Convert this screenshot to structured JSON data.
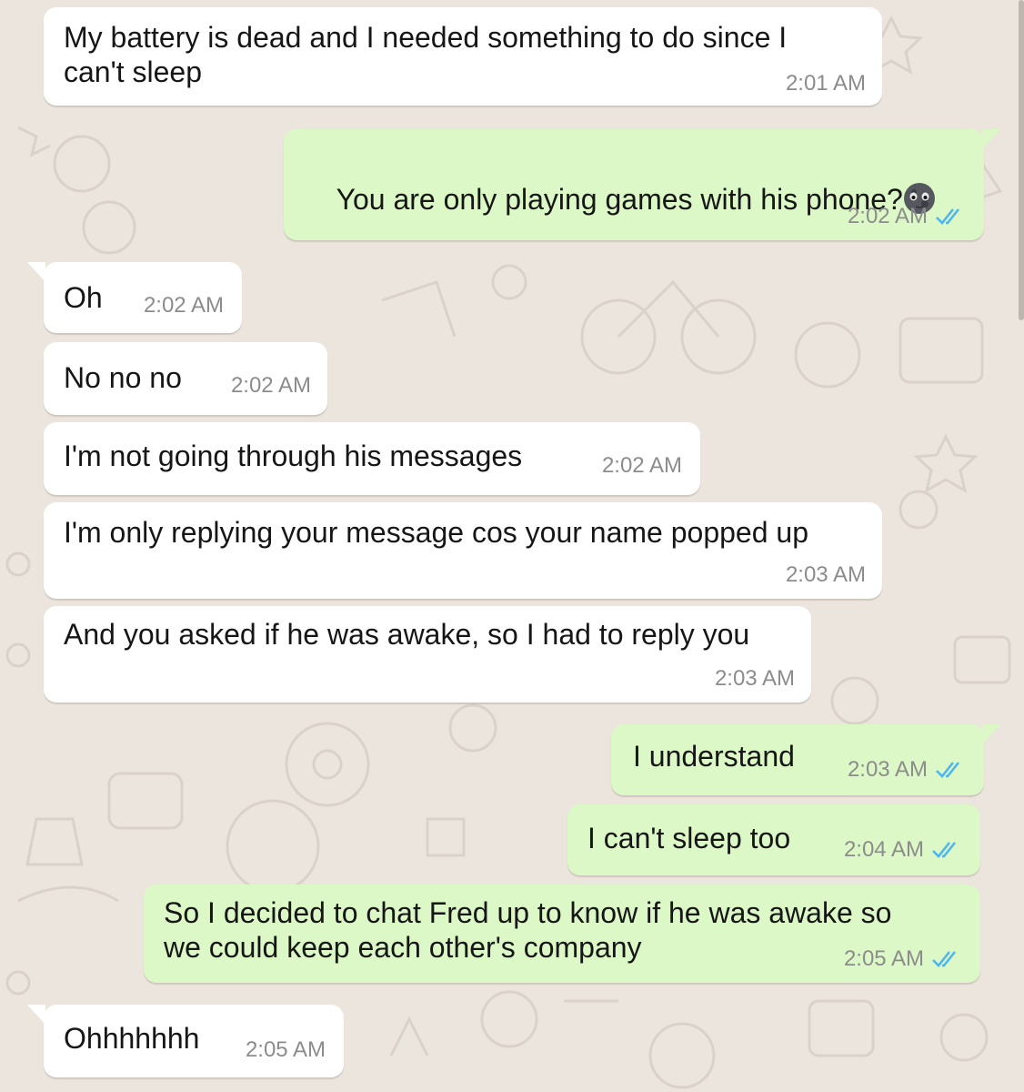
{
  "theme": {
    "incoming_bg": "#ffffff",
    "outgoing_bg": "#dcf8c6",
    "read_tick_color": "#4fb6ec",
    "wallpaper_bg": "#ece5dd"
  },
  "messages": [
    {
      "direction": "in",
      "text": "My battery is dead and I needed something to do since I\ncan't sleep",
      "time": "2:01 AM"
    },
    {
      "direction": "out",
      "text": "You are only playing games with his phone?",
      "emoji": "new-moon-face",
      "time": "2:02 AM",
      "status": "read"
    },
    {
      "direction": "in",
      "text": "Oh",
      "time": "2:02 AM"
    },
    {
      "direction": "in",
      "text": "No no no",
      "time": "2:02 AM"
    },
    {
      "direction": "in",
      "text": "I'm not going through his messages",
      "time": "2:02 AM"
    },
    {
      "direction": "in",
      "text": "I'm only replying your message cos your name popped up",
      "time": "2:03 AM"
    },
    {
      "direction": "in",
      "text": "And you asked if he was awake, so I had to reply you",
      "time": "2:03 AM"
    },
    {
      "direction": "out",
      "text": "I understand",
      "time": "2:03 AM",
      "status": "read"
    },
    {
      "direction": "out",
      "text": "I can't sleep too",
      "time": "2:04 AM",
      "status": "read"
    },
    {
      "direction": "out",
      "text": "So I decided to chat Fred up to know if he was awake so\nwe could keep each other's company",
      "time": "2:05 AM",
      "status": "read"
    },
    {
      "direction": "in",
      "text": "Ohhhhhhh",
      "time": "2:05 AM"
    }
  ]
}
